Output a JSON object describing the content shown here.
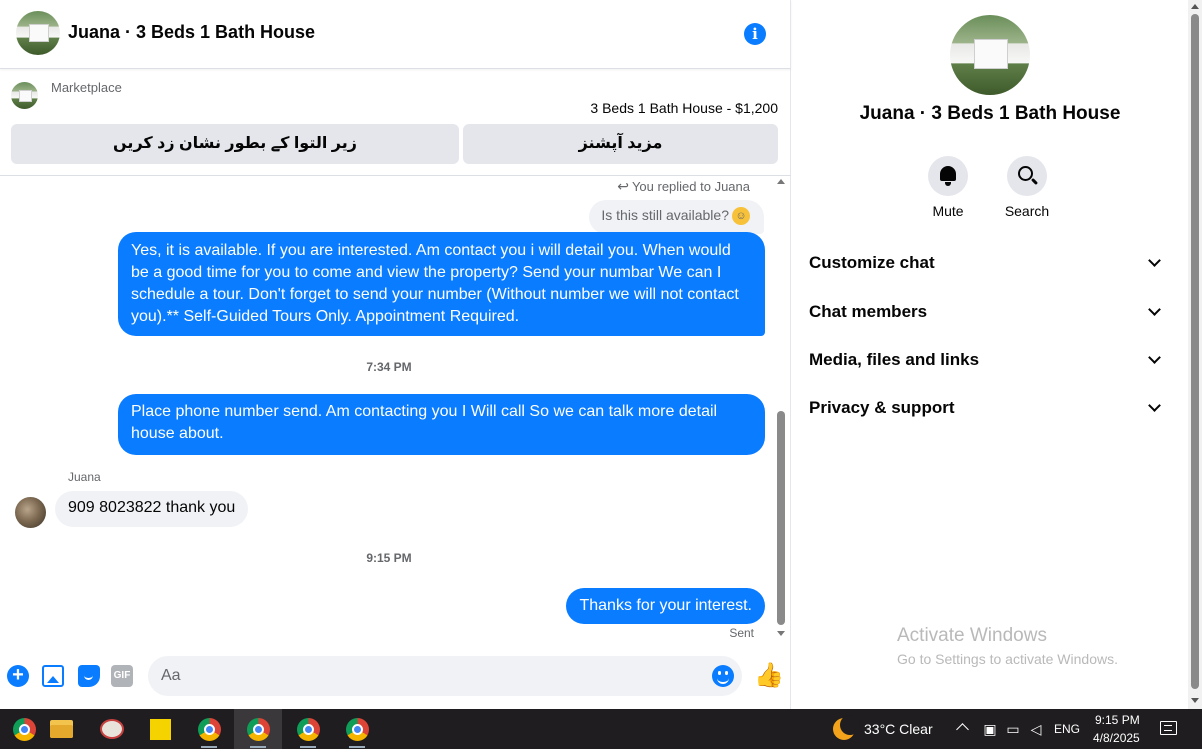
{
  "header": {
    "title": "Juana · 3 Beds 1 Bath House"
  },
  "listing": {
    "label": "Marketplace",
    "price_text": "3 Beds 1 Bath House - $1,200",
    "mark_pending_label": "زیر التوا کے بطور نشان زد کریں",
    "more_actions_label": "مزید آپشنز"
  },
  "messages": {
    "replied_to": "You replied to Juana",
    "quoted_text": "Is this still available?",
    "msg1": "Yes, it is available. If you are interested.  Am contact you i will detail you.  When would be a good time for you to come and view the property? Send your numbar We can I schedule a tour.  Don't forget to send your number (Without number we will not contact you).** Self-Guided Tours Only. Appointment Required.",
    "time1": "7:34 PM",
    "msg2": "Place phone number send. Am contacting you I Will call So we can talk more detail house about.",
    "sender_name": "Juana",
    "msg3": "909 8023822 thank you",
    "time2": "9:15 PM",
    "msg4": "Thanks for your interest.",
    "sent_label": "Sent"
  },
  "composer": {
    "placeholder": "Aa",
    "gif_label": "GIF"
  },
  "info_pane": {
    "name": "Juana · 3 Beds 1 Bath House",
    "mute_label": "Mute",
    "search_label": "Search",
    "sections": [
      "Customize chat",
      "Chat members",
      "Media, files and links",
      "Privacy & support"
    ],
    "activate_title": "Activate Windows",
    "activate_sub": "Go to Settings to activate Windows."
  },
  "taskbar": {
    "weather": "33°C  Clear",
    "language": "ENG",
    "time": "9:15 PM",
    "date": "4/8/2025"
  },
  "colors": {
    "accent": "#0a7cff",
    "bubble_in": "#f0f2f5",
    "taskbar": "#1f1d1f"
  }
}
